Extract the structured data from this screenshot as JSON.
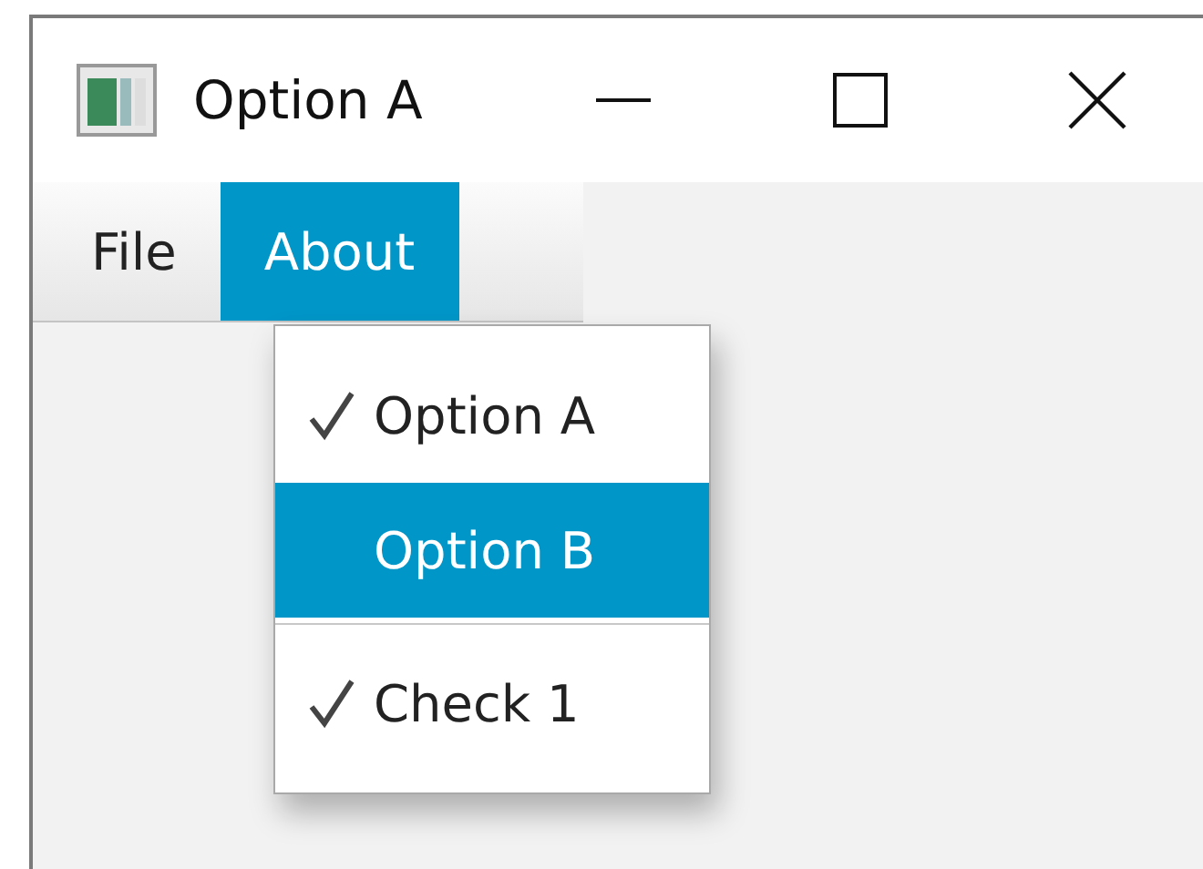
{
  "window": {
    "title": "Option A"
  },
  "menubar": [
    {
      "label": "File",
      "selected": false
    },
    {
      "label": "About",
      "selected": true
    }
  ],
  "menu": {
    "groups": [
      {
        "items": [
          {
            "label": "Option A",
            "checked": true,
            "selected": false
          },
          {
            "label": "Option B",
            "checked": false,
            "selected": true
          }
        ]
      },
      {
        "items": [
          {
            "label": "Check 1",
            "checked": true,
            "selected": false
          }
        ]
      }
    ]
  }
}
